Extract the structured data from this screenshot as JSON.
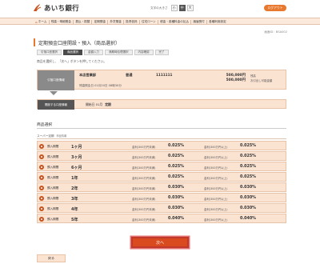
{
  "header": {
    "logo_text": "あいち銀行",
    "fontsize_label": "文字の大きさ",
    "fontsize_options": [
      "小",
      "中",
      "大"
    ],
    "fontsize_selected": "中",
    "logout_label": "ログアウト",
    "colors": {
      "accent": "#e8782e",
      "brand": "#c8521c"
    }
  },
  "nav": {
    "items": [
      "ホーム",
      "残高・明細照会",
      "振込・振替",
      "定期預金",
      "外貨預金",
      "投資信託",
      "住宅ローン",
      "税金・各種料金の払込",
      "諸届受付",
      "各種利用設定"
    ]
  },
  "screen_id": "画面ID：BSA002",
  "page_title": "定期預金口座開設・預入（商品選択）",
  "steps": [
    "引落口座選択",
    "商品選択",
    "金額入力",
    "満期時処理選択",
    "内容確認",
    "完了"
  ],
  "active_step": 1,
  "instruction": "商品を選択し、「次へ」ボタンを押してください。",
  "account": {
    "label": "引落口座情報",
    "branch": "本店営業部",
    "type": "普通",
    "number": "1111111",
    "amount1": "500,000円",
    "note1": "残高",
    "amount2": "500,000円",
    "note2": "お引出し可能金額",
    "sub": "残高照会日 01月20日 08時30分"
  },
  "period": {
    "label": "開設する口座情報",
    "prefix": "開始日 01月",
    "value": "定期"
  },
  "section_title": "商品選択",
  "super_title": "スーパー定期",
  "super_sub": "商品情報",
  "products": [
    {
      "type": "預入期間",
      "term": "1ヶ月",
      "rate1_label": "金利(300万円未満)",
      "rate1": "0.025%",
      "rate2_label": "金利(300万円以上)",
      "rate2": "0.025%"
    },
    {
      "type": "預入期間",
      "term": "3ヶ月",
      "rate1_label": "金利(300万円未満)",
      "rate1": "0.025%",
      "rate2_label": "金利(300万円以上)",
      "rate2": "0.025%"
    },
    {
      "type": "預入期間",
      "term": "6ヶ月",
      "rate1_label": "金利(300万円未満)",
      "rate1": "0.025%",
      "rate2_label": "金利(300万円以上)",
      "rate2": "0.025%"
    },
    {
      "type": "預入期間",
      "term": "1年",
      "rate1_label": "金利(300万円未満)",
      "rate1": "0.025%",
      "rate2_label": "金利(300万円以上)",
      "rate2": "0.025%"
    },
    {
      "type": "預入期間",
      "term": "2年",
      "rate1_label": "金利(300万円未満)",
      "rate1": "0.030%",
      "rate2_label": "金利(300万円以上)",
      "rate2": "0.030%"
    },
    {
      "type": "預入期間",
      "term": "3年",
      "rate1_label": "金利(300万円未満)",
      "rate1": "0.030%",
      "rate2_label": "金利(300万円以上)",
      "rate2": "0.030%"
    },
    {
      "type": "預入期間",
      "term": "4年",
      "rate1_label": "金利(300万円未満)",
      "rate1": "0.030%",
      "rate2_label": "金利(300万円以上)",
      "rate2": "0.030%"
    },
    {
      "type": "預入期間",
      "term": "5年",
      "rate1_label": "金利(300万円未満)",
      "rate1": "0.040%",
      "rate2_label": "金利(300万円以上)",
      "rate2": "0.040%"
    }
  ],
  "next_label": "次へ",
  "back_label": "戻る"
}
